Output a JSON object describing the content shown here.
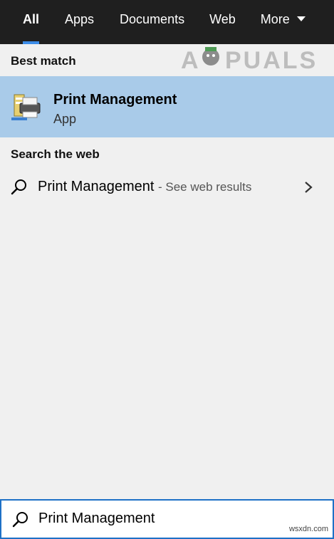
{
  "tabs": [
    {
      "label": "All",
      "active": true
    },
    {
      "label": "Apps"
    },
    {
      "label": "Documents"
    },
    {
      "label": "Web"
    },
    {
      "label": "More",
      "has_dropdown": true
    }
  ],
  "best_match": {
    "section_title": "Best match",
    "item": {
      "name": "Print Management",
      "type": "App",
      "icon": "printer-icon"
    }
  },
  "web": {
    "section_title": "Search the web",
    "item": {
      "query": "Print Management",
      "suffix": "- See web results",
      "icon": "search-icon",
      "chevron": "chevron-right-icon"
    }
  },
  "search": {
    "value": "Print Management",
    "icon": "search-icon"
  },
  "watermark": {
    "text": "APPUALS"
  },
  "credit": "wsxdn.com",
  "colors": {
    "topbar": "#1f1f1f",
    "accent": "#3c8ce7",
    "selection": "#a9cbe9",
    "background": "#f0f0f0"
  }
}
